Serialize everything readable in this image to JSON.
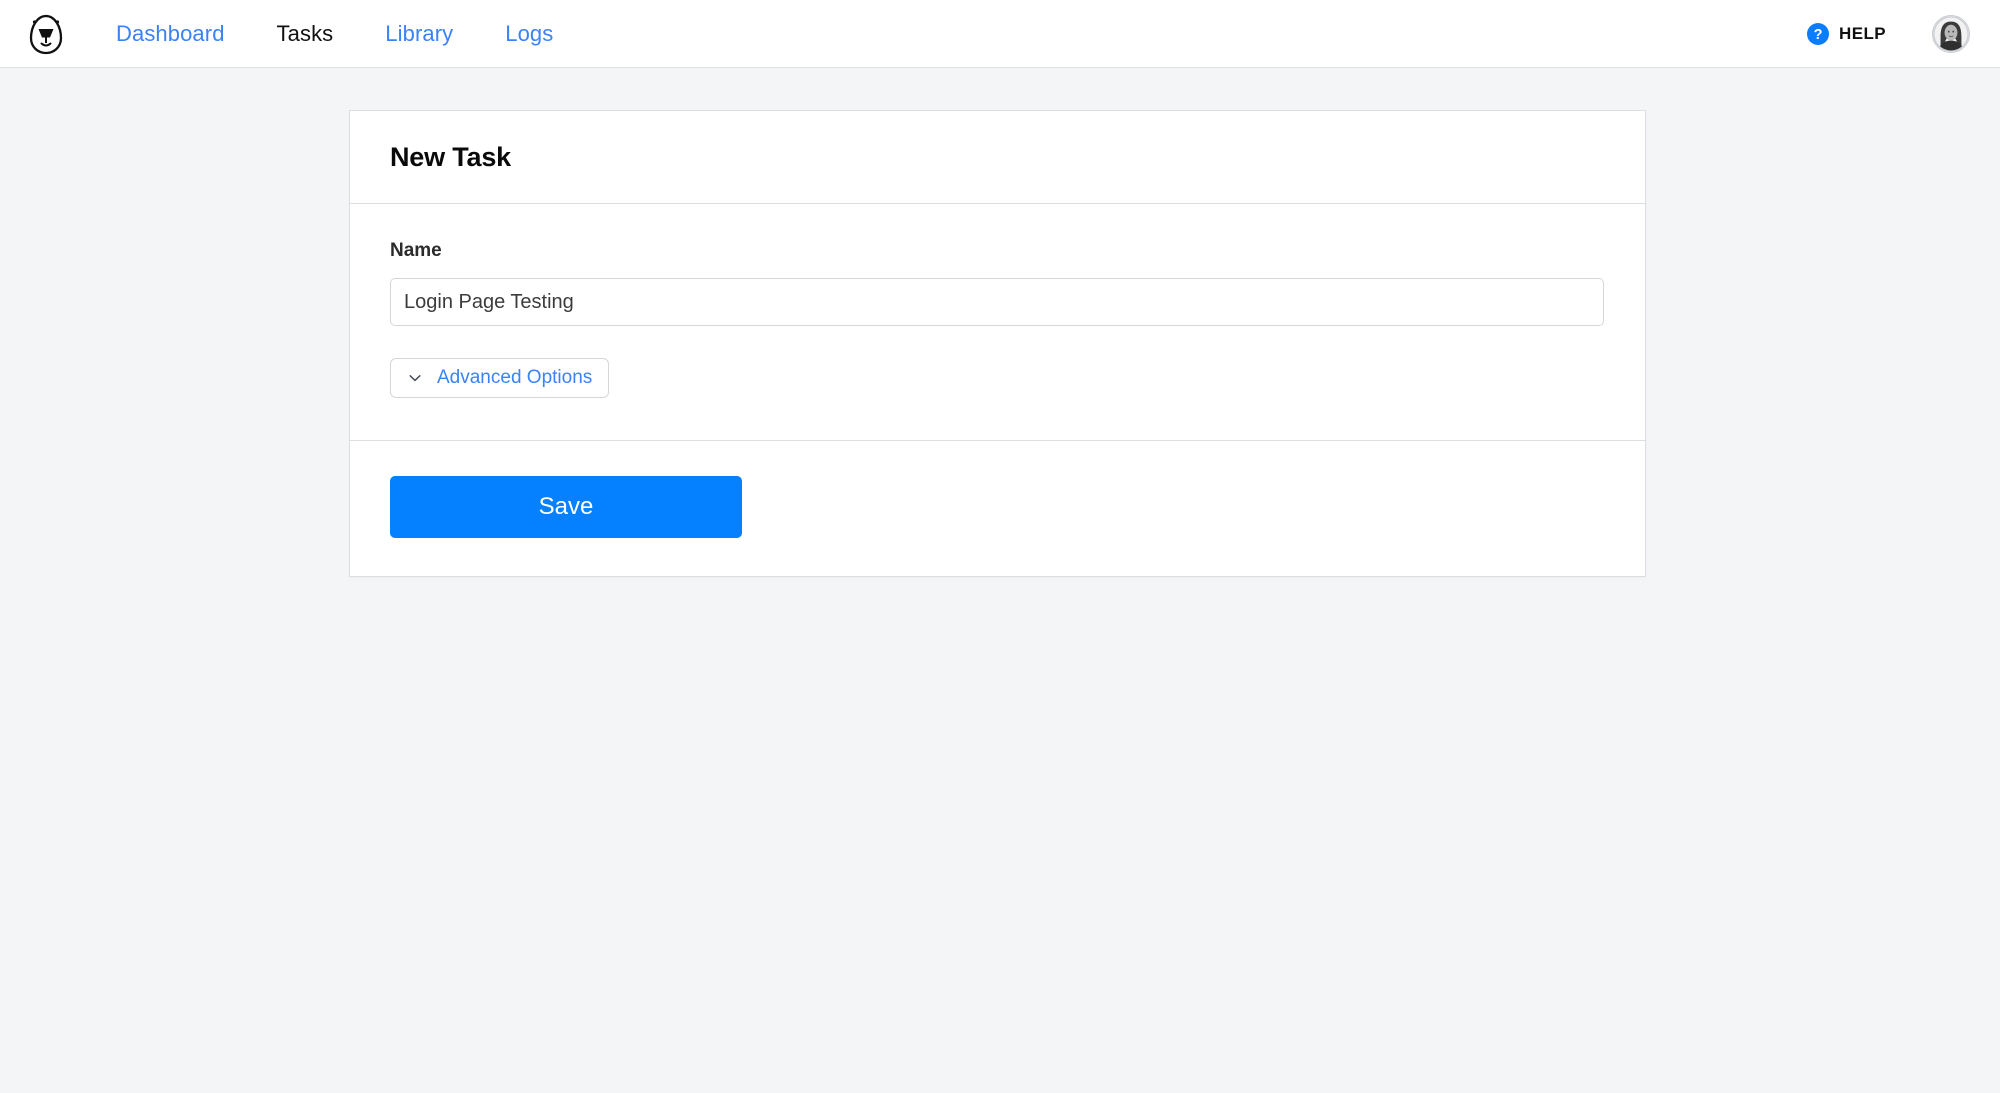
{
  "header": {
    "logo_icon": "egg-mascot-logo",
    "nav": [
      {
        "label": "Dashboard",
        "active": false
      },
      {
        "label": "Tasks",
        "active": true
      },
      {
        "label": "Library",
        "active": false
      },
      {
        "label": "Logs",
        "active": false
      }
    ],
    "help": {
      "icon": "question-circle-icon",
      "label": "HELP"
    },
    "avatar_alt": "user-avatar"
  },
  "card": {
    "title": "New Task",
    "name_field": {
      "label": "Name",
      "value": "Login Page Testing",
      "placeholder": ""
    },
    "advanced_options": {
      "label": "Advanced Options",
      "icon": "chevron-down-icon"
    },
    "save_label": "Save"
  },
  "colors": {
    "accent_blue": "#0580ff",
    "link_blue": "#3b82f6",
    "page_bg": "#f4f5f7",
    "card_border": "#dcdee1",
    "text_dark": "#111111"
  }
}
